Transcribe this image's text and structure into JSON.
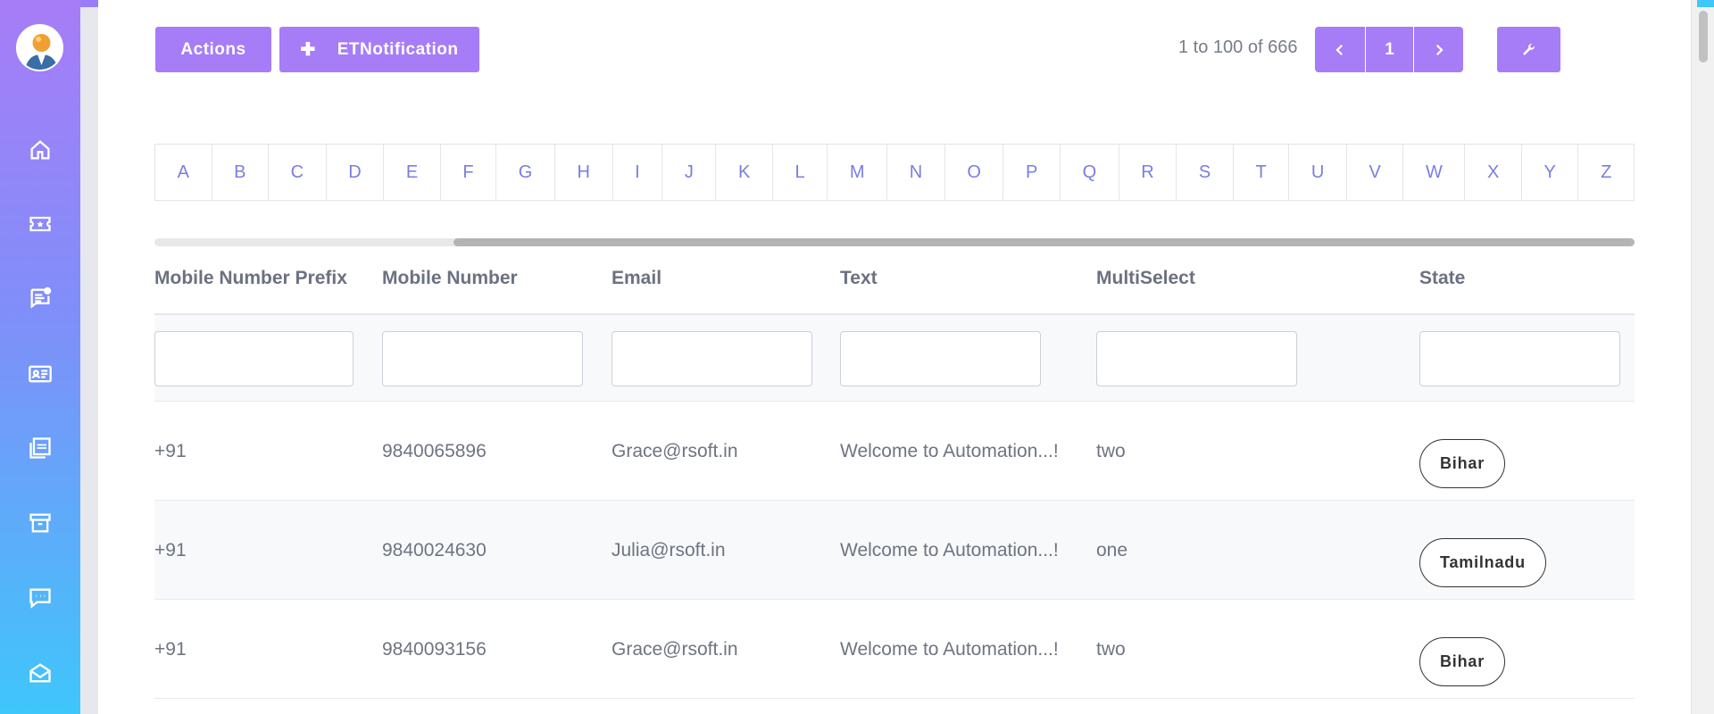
{
  "sidebar": {
    "items": [
      {
        "icon": "home-icon"
      },
      {
        "icon": "ticket-icon"
      },
      {
        "icon": "notes-icon"
      },
      {
        "icon": "contact-card-icon"
      },
      {
        "icon": "pdf-icon"
      },
      {
        "icon": "archive-icon"
      },
      {
        "icon": "chat-icon"
      },
      {
        "icon": "mail-open-icon"
      }
    ]
  },
  "toolbar": {
    "actions_label": "Actions",
    "notification_label": "ETNotification",
    "plus_glyph": "✚"
  },
  "pagination": {
    "range_text": "1 to 100 of 666",
    "current_page": "1"
  },
  "alphabet": [
    "A",
    "B",
    "C",
    "D",
    "E",
    "F",
    "G",
    "H",
    "I",
    "J",
    "K",
    "L",
    "M",
    "N",
    "O",
    "P",
    "Q",
    "R",
    "S",
    "T",
    "U",
    "V",
    "W",
    "X",
    "Y",
    "Z"
  ],
  "table": {
    "columns": [
      "Mobile Number Prefix",
      "Mobile Number",
      "Email",
      "Text",
      "MultiSelect",
      "State"
    ],
    "rows": [
      {
        "prefix": "+91",
        "mobile": "9840065896",
        "email": "Grace@rsoft.in",
        "text": "Welcome to Automation...!",
        "multiselect": "two",
        "state": "Bihar"
      },
      {
        "prefix": "+91",
        "mobile": "9840024630",
        "email": "Julia@rsoft.in",
        "text": "Welcome to Automation...!",
        "multiselect": "one",
        "state": "Tamilnadu"
      },
      {
        "prefix": "+91",
        "mobile": "9840093156",
        "email": "Grace@rsoft.in",
        "text": "Welcome to Automation...!",
        "multiselect": "two",
        "state": "Bihar"
      }
    ]
  },
  "colors": {
    "accent": "#a77cf7",
    "sidebar_top": "#a77cf7",
    "sidebar_bottom": "#3fc6fb",
    "letter": "#7a7ee0"
  }
}
